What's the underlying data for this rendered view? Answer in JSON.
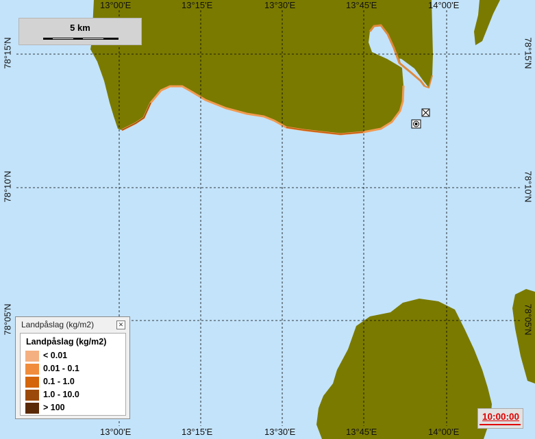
{
  "map": {
    "land_color": "#7a7a00",
    "sea_color": "#c3e3fa",
    "grid_color": "#000000"
  },
  "longitude_labels_top": [
    "13°00'E",
    "13°15'E",
    "13°30'E",
    "13°45'E",
    "14°00'E"
  ],
  "longitude_labels_bottom": [
    "13°00'E",
    "13°15'E",
    "13°30'E",
    "13°45'E",
    "14°00'E"
  ],
  "latitude_labels_left": [
    "78°15'N",
    "78°10'N",
    "78°05'N"
  ],
  "latitude_labels_right": [
    "78°15'N",
    "78°10'N",
    "78°05'N"
  ],
  "scale_bar": {
    "label": "5 km"
  },
  "legend": {
    "window_title": "Landpåslag (kg/m2)",
    "title": "Landpåslag (kg/m2)",
    "close_icon": "close-icon",
    "items": [
      {
        "label": "< 0.01",
        "color": "#f4b080"
      },
      {
        "label": "0.01 - 0.1",
        "color": "#f08c3c"
      },
      {
        "label": "0.1 - 1.0",
        "color": "#d4650a"
      },
      {
        "label": "1.0 - 10.0",
        "color": "#9c4a0c"
      },
      {
        "label": "> 100",
        "color": "#5a2a08"
      }
    ]
  },
  "markers": [
    {
      "name": "boxed-x-marker-icon"
    },
    {
      "name": "boxed-target-marker-icon"
    }
  ],
  "time": {
    "value": "10:00:00",
    "color": "#e00000"
  }
}
